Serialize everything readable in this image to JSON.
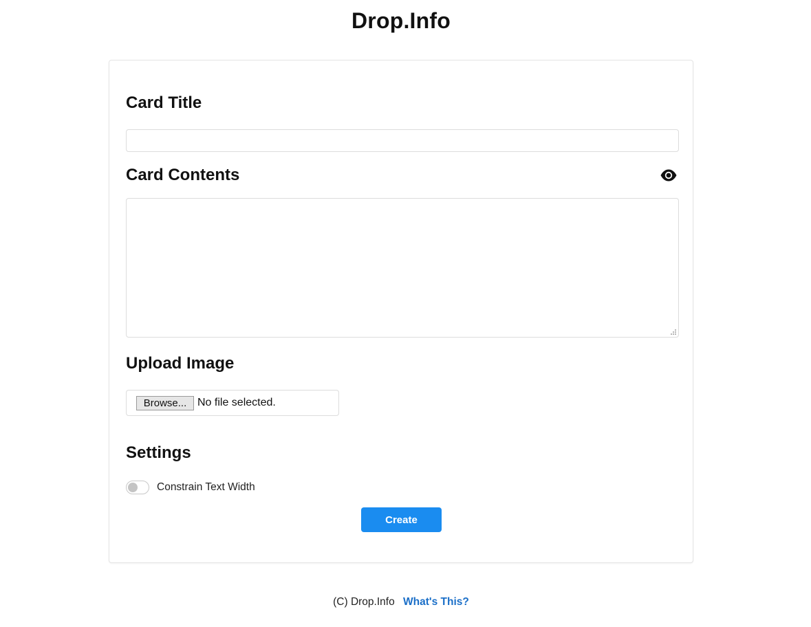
{
  "site": {
    "title": "Drop.Info"
  },
  "form": {
    "card_title_heading": "Card Title",
    "card_title_value": "",
    "card_contents_heading": "Card Contents",
    "card_contents_value": "",
    "preview_icon": "eye-icon",
    "upload_heading": "Upload Image",
    "browse_label": "Browse...",
    "file_status": "No file selected.",
    "settings_heading": "Settings",
    "constrain_label": "Constrain Text Width",
    "constrain_enabled": false,
    "create_label": "Create"
  },
  "footer": {
    "copyright": "(C) Drop.Info",
    "link_label": "What's This?"
  },
  "colors": {
    "accent": "#1a8cf0",
    "link": "#1b6fc8",
    "border": "#dcdcdc"
  }
}
